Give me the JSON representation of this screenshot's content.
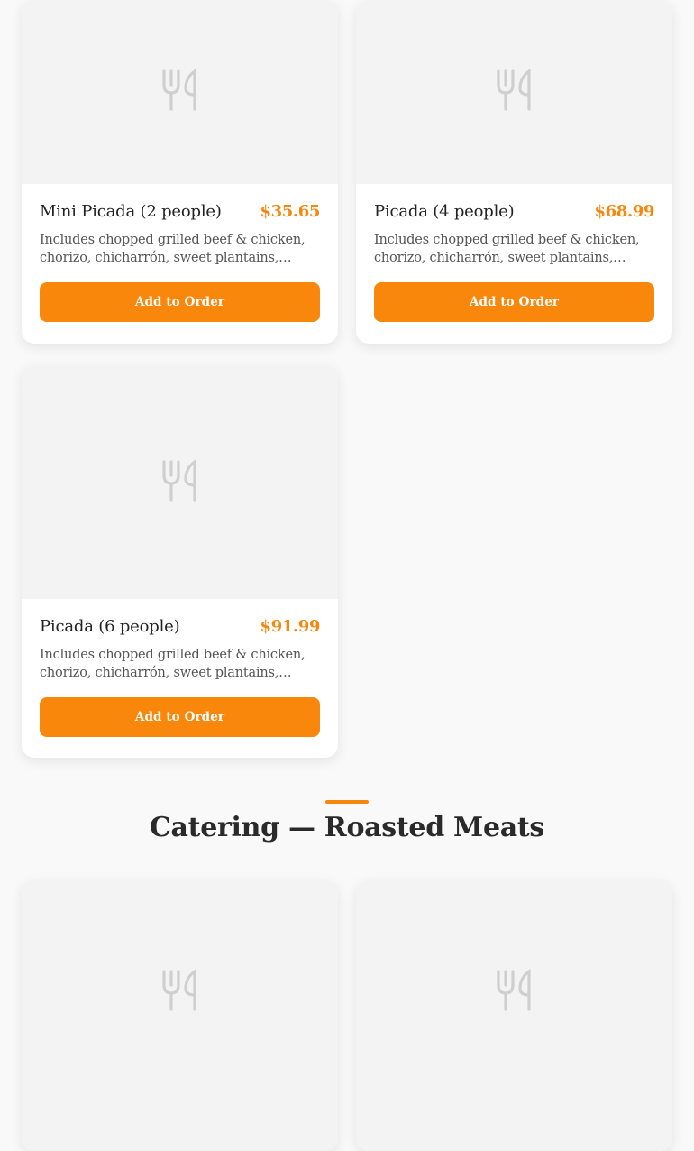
{
  "items": [
    {
      "name": "Mini Picada (2 people)",
      "price": "$35.65",
      "description": "Includes chopped grilled beef & chicken, chorizo, chicharrón, sweet plantains, yellow rice, beans and salad for two people to share.",
      "button": "Add to Order",
      "icon": "fork-knife-icon"
    },
    {
      "name": "Picada (4 people)",
      "price": "$68.99",
      "description": "Includes chopped grilled beef & chicken, chorizo, chicharrón, sweet plantains, yellow rice, beans and salad for four people to share.",
      "button": "Add to Order",
      "icon": "fork-knife-icon"
    },
    {
      "name": "Picada (6 people)",
      "price": "$91.99",
      "description": "Includes chopped grilled beef & chicken, chorizo, chicharrón, sweet plantains, yellow rice, beans and salad for six people to share.",
      "button": "Add to Order",
      "icon": "fork-knife-icon"
    }
  ],
  "section": {
    "title": "Catering — Roasted Meats"
  },
  "colors": {
    "accent": "#f5870c",
    "card_bg": "#ffffff",
    "image_placeholder": "#f3f3f3"
  }
}
